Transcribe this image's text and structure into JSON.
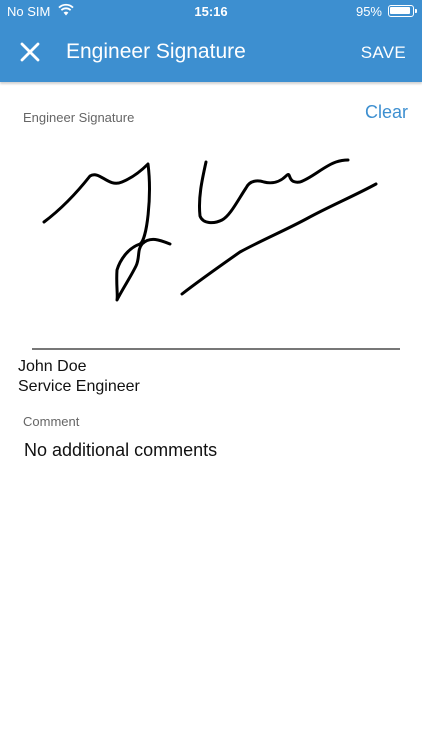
{
  "status_bar": {
    "carrier": "No SIM",
    "time": "15:16",
    "battery": "95%",
    "battery_level": 0.95
  },
  "nav": {
    "title": "Engineer Signature",
    "save_label": "SAVE",
    "close_icon": "close-icon"
  },
  "signature": {
    "label": "Engineer Signature",
    "clear_label": "Clear"
  },
  "signer": {
    "name": "John Doe",
    "role": "Service Engineer"
  },
  "comment": {
    "label": "Comment",
    "value": "No additional comments"
  },
  "colors": {
    "accent": "#3d8fd0",
    "label_grey": "#666666",
    "ink": "#000000"
  }
}
